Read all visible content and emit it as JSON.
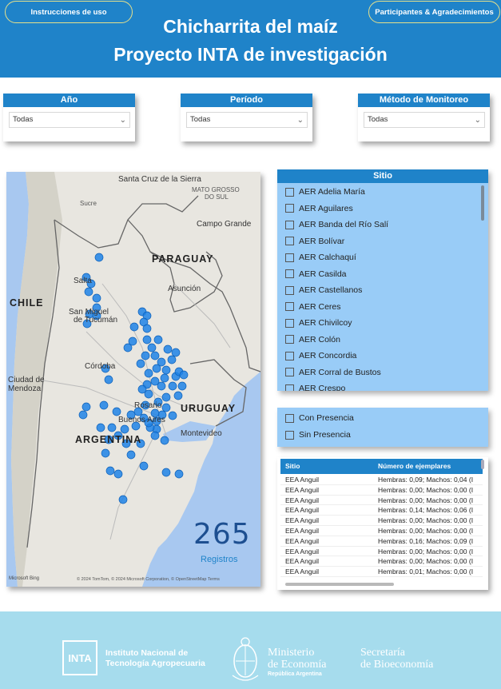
{
  "header": {
    "btn_instrucciones": "Instrucciones de uso",
    "btn_participantes": "Participantes & Agradecimientos",
    "title_line1": "Chicharrita del maíz",
    "title_line2": "Proyecto INTA de investigación"
  },
  "slicers": [
    {
      "title": "Año",
      "value": "Todas"
    },
    {
      "title": "Período",
      "value": "Todas"
    },
    {
      "title": "Método de Monitoreo",
      "value": "Todas"
    }
  ],
  "map": {
    "labels": {
      "santa_cruz": "Santa Cruz de la Sierra",
      "mato_grosso": "MATO GROSSO",
      "do_sul": "DO SUL",
      "sucre": "Sucre",
      "campo_grande": "Campo Grande",
      "paraguay": "PARAGUAY",
      "asuncion": "Asunción",
      "chile": "CHILE",
      "san_miguel1": "San Miguel",
      "san_miguel2": "de Tucumán",
      "salta": "Salta",
      "cordoba": "Córdoba",
      "ciudad1": "Ciudad de",
      "ciudad2": "Mendoza",
      "rosario": "Rosario",
      "uruguay": "URUGUAY",
      "buenos_aires": "Buenos Aires",
      "montevideo": "Montevideo",
      "argentina": "ARGENTINA"
    },
    "kpi_value": "265",
    "kpi_label": "Registros",
    "attribution": "© 2024 TomTom, © 2024 Microsoft Corporation, © OpenStreetMap  Terms",
    "bing_label": "Microsoft Bing",
    "marker_color": "#1f83e6"
  },
  "sitio": {
    "title": "Sitio",
    "items": [
      "AER Adelia María",
      "AER Aguilares",
      "AER Banda del Río Salí",
      "AER Bolívar",
      "AER Calchaquí",
      "AER Casilda",
      "AER Castellanos",
      "AER Ceres",
      "AER Chivilcoy",
      "AER Colón",
      "AER Concordia",
      "AER Corral de Bustos",
      "AER Crespo"
    ]
  },
  "presencia": {
    "items": [
      "Con Presencia",
      "Sin Presencia"
    ]
  },
  "table": {
    "headers": [
      "Sitio",
      "Número de ejemplares"
    ],
    "rows": [
      [
        "EEA Anguil",
        "Hembras: 0,09; Machos: 0,04 (I"
      ],
      [
        "EEA Anguil",
        "Hembras: 0,00; Machos: 0,00 (I"
      ],
      [
        "EEA Anguil",
        "Hembras: 0,00; Machos: 0,00 (I"
      ],
      [
        "EEA Anguil",
        "Hembras: 0,14; Machos: 0,06 (I"
      ],
      [
        "EEA Anguil",
        "Hembras: 0,00; Machos: 0,00 (I"
      ],
      [
        "EEA Anguil",
        "Hembras: 0,00; Machos: 0,00 (I"
      ],
      [
        "EEA Anguil",
        "Hembras: 0,16; Machos: 0,09 (I"
      ],
      [
        "EEA Anguil",
        "Hembras: 0,00; Machos: 0,00 (I"
      ],
      [
        "EEA Anguil",
        "Hembras: 0,00; Machos: 0,00 (I"
      ],
      [
        "EEA Anguil",
        "Hembras: 0,01; Machos: 0,00 (I"
      ]
    ]
  },
  "footer": {
    "inta_logo": "INTA",
    "inta_line1": "Instituto Nacional de",
    "inta_line2": "Tecnología Agropecuaria",
    "min_line1": "Ministerio",
    "min_line2": "de Economía",
    "min_line3": "República Argentina",
    "sec_line1": "Secretaría",
    "sec_line2": "de Bioeconomía"
  },
  "colors": {
    "accent": "#1f83c9",
    "slicer_panel": "#99ccf7",
    "footer": "#a6dced",
    "pill_border": "#e6e08a"
  }
}
